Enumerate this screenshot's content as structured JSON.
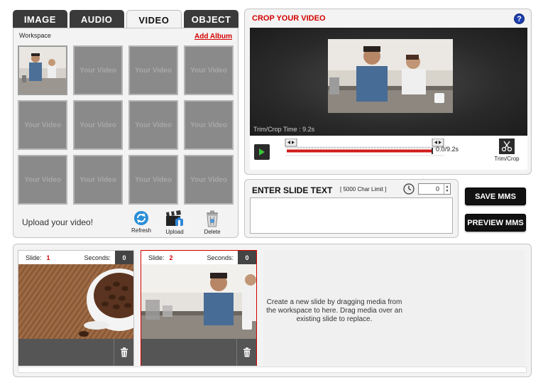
{
  "tabs": [
    {
      "label": "IMAGE",
      "active": false
    },
    {
      "label": "AUDIO",
      "active": false
    },
    {
      "label": "VIDEO",
      "active": true
    },
    {
      "label": "OBJECT",
      "active": false
    }
  ],
  "workspace": {
    "label": "Workspace",
    "add_album": "Add Album",
    "placeholder_text": "Your Video",
    "upload_text": "Upload your video!",
    "tools": {
      "refresh": "Refresh",
      "upload": "Upload",
      "delete": "Delete"
    }
  },
  "crop": {
    "title": "CROP YOUR VIDEO",
    "help": "?",
    "trim_time": "Trim/Crop Time : 9.2s",
    "time_readout": "0.0/9.2s",
    "trim_button": "Trim/Crop"
  },
  "slide_text": {
    "title": "ENTER SLIDE TEXT",
    "char_limit": "[ 5000 Char Limit ]",
    "seconds_value": "0",
    "content": ""
  },
  "buttons": {
    "save": "SAVE MMS",
    "preview": "PREVIEW MMS"
  },
  "slides": [
    {
      "label": "Slide:",
      "number": "1",
      "seconds_label": "Seconds:",
      "seconds": "0"
    },
    {
      "label": "Slide:",
      "number": "2",
      "seconds_label": "Seconds:",
      "seconds": "0"
    }
  ],
  "drop_hint": "Create a new slide by dragging media from the workspace to here. Drag media over an existing slide to replace.",
  "colors": {
    "accent_red": "#d40000",
    "tab_dark": "#3a3a3a",
    "panel_bg": "#f3f3f3",
    "button_dark": "#111111",
    "help_blue": "#1e3fae"
  },
  "icons": {
    "refresh": "refresh-icon",
    "upload": "clapperboard-upload-icon",
    "delete": "trash-can-icon",
    "play": "play-icon",
    "trim": "scissors-icon",
    "clock": "clock-icon",
    "slide_delete": "trash-icon"
  }
}
